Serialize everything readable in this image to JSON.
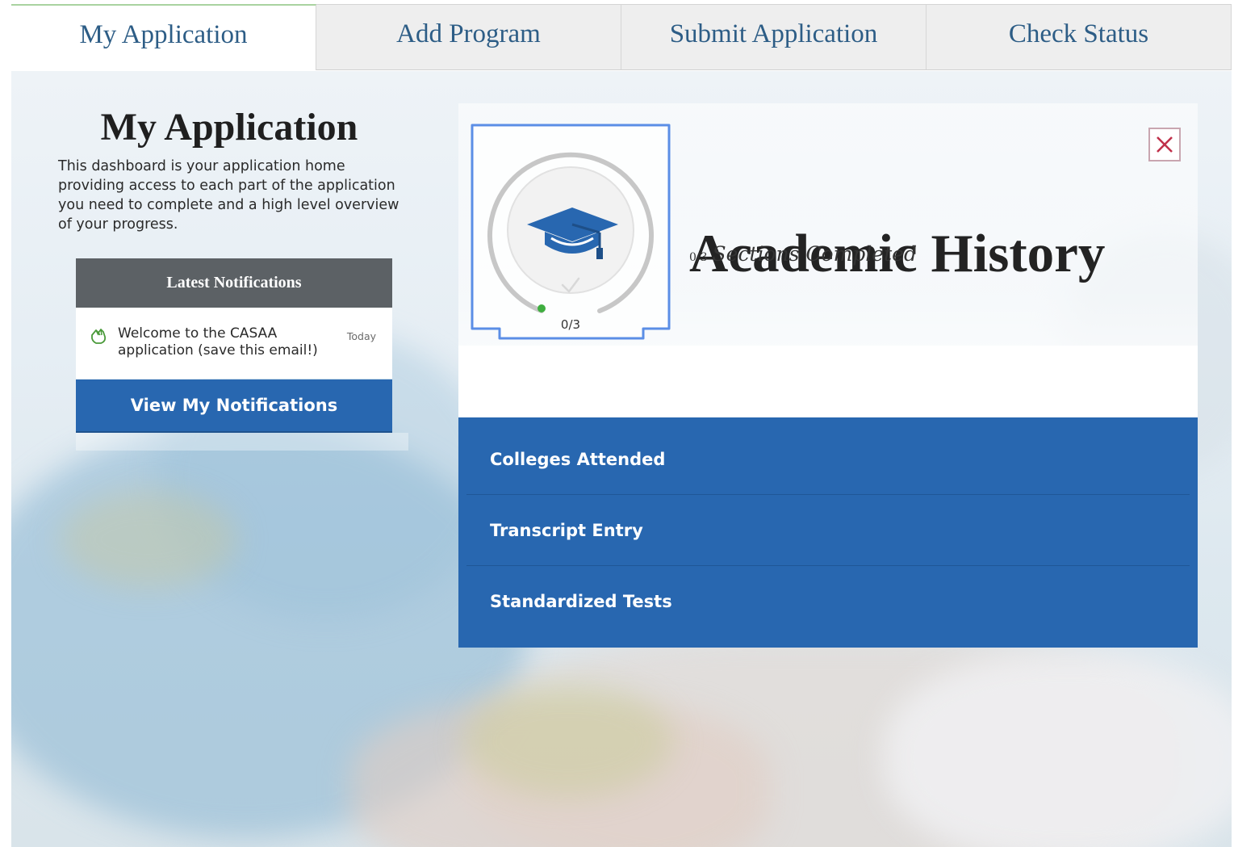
{
  "tabs": [
    {
      "label": "My Application",
      "active": true
    },
    {
      "label": "Add Program",
      "active": false
    },
    {
      "label": "Submit Application",
      "active": false
    },
    {
      "label": "Check Status",
      "active": false
    }
  ],
  "dashboard": {
    "title": "My Application",
    "description": "This dashboard is your application home providing access to each part of the application you need to complete and a high level overview of your progress."
  },
  "notifications": {
    "header": "Latest Notifications",
    "items": [
      {
        "text": "Welcome to the CASAA application (save this email!)",
        "time": "Today",
        "icon": "hand-wave-icon"
      }
    ],
    "button_label": "View My Notifications"
  },
  "module": {
    "title": "Academic History",
    "completed_fraction": "0/3",
    "completed_label": "Sections Completed",
    "progress_text": "0/3",
    "progress_value": 0,
    "icon": "graduation-cap-icon",
    "close_icon": "close-icon",
    "sections": [
      {
        "label": "Colleges Attended"
      },
      {
        "label": "Transcript Entry"
      },
      {
        "label": "Standardized Tests"
      }
    ]
  },
  "colors": {
    "primary_blue": "#2867b0",
    "tab_text": "#2d5d86",
    "notification_header": "#5c6165",
    "close_x": "#c0304a",
    "progress_dot": "#3fae3f"
  }
}
